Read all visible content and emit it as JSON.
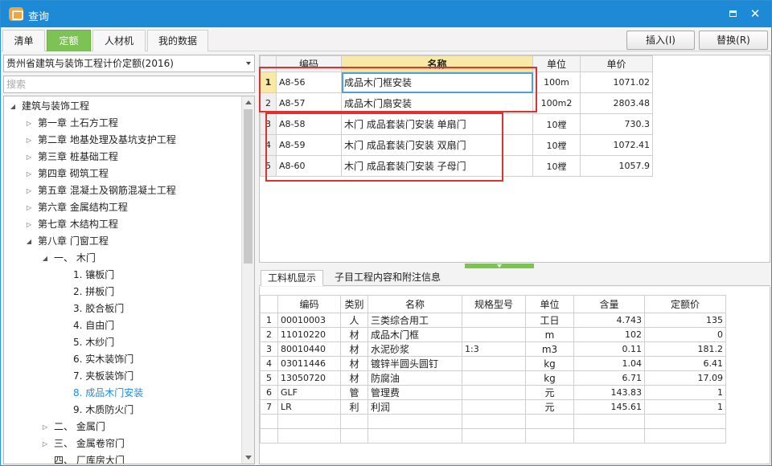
{
  "window": {
    "title": "查询",
    "maximize_label": "",
    "close_label": "✕"
  },
  "tabs": [
    "清单",
    "定额",
    "人材机",
    "我的数据"
  ],
  "toolbar": {
    "insert_label": "插入(I)",
    "replace_label": "替换(R)"
  },
  "library": {
    "selected": "贵州省建筑与装饰工程计价定额(2016)"
  },
  "search": {
    "placeholder": "搜索"
  },
  "tree": [
    {
      "label": "建筑与装饰工程",
      "state": "expanded"
    },
    {
      "label": "第一章  土石方工程",
      "state": "collapsed"
    },
    {
      "label": "第二章  地基处理及基坑支护工程",
      "state": "collapsed"
    },
    {
      "label": "第三章  桩基础工程",
      "state": "collapsed"
    },
    {
      "label": "第四章  砌筑工程",
      "state": "collapsed"
    },
    {
      "label": "第五章  混凝土及钢筋混凝土工程",
      "state": "collapsed"
    },
    {
      "label": "第六章  金属结构工程",
      "state": "collapsed"
    },
    {
      "label": "第七章  木结构工程",
      "state": "collapsed"
    },
    {
      "label": "第八章  门窗工程",
      "state": "expanded"
    },
    {
      "label": "一、  木门",
      "state": "expanded"
    },
    {
      "label": "1.  镶板门",
      "state": "leaf"
    },
    {
      "label": "2.  拼板门",
      "state": "leaf"
    },
    {
      "label": "3.  胶合板门",
      "state": "leaf"
    },
    {
      "label": "4.  自由门",
      "state": "leaf"
    },
    {
      "label": "5.  木纱门",
      "state": "leaf"
    },
    {
      "label": "6.  实木装饰门",
      "state": "leaf"
    },
    {
      "label": "7.  夹板装饰门",
      "state": "leaf"
    },
    {
      "label": "8.  成品木门安装",
      "state": "selected"
    },
    {
      "label": "9.  木质防火门",
      "state": "leaf"
    },
    {
      "label": "二、  金属门",
      "state": "collapsed"
    },
    {
      "label": "三、  金属卷帘门",
      "state": "collapsed"
    },
    {
      "label": "四、  厂库房大门",
      "state": "none"
    }
  ],
  "quota_table": {
    "headers": [
      "",
      "编码",
      "名称",
      "单位",
      "单价"
    ],
    "rows": [
      {
        "no": "1",
        "code": "A8-56",
        "name": "成品木门框安装",
        "unit": "100m",
        "price": "1071.02"
      },
      {
        "no": "2",
        "code": "A8-57",
        "name": "成品木门扇安装",
        "unit": "100m2",
        "price": "2803.48"
      },
      {
        "no": "3",
        "code": "A8-58",
        "name": "木门 成品套装门安装 单扇门",
        "unit": "10樘",
        "price": "730.3"
      },
      {
        "no": "4",
        "code": "A8-59",
        "name": "木门 成品套装门安装 双扇门",
        "unit": "10樘",
        "price": "1072.41"
      },
      {
        "no": "5",
        "code": "A8-60",
        "name": "木门 成品套装门安装 子母门",
        "unit": "10樘",
        "price": "1057.9"
      }
    ]
  },
  "sub_tabs": [
    "工料机显示",
    "子目工程内容和附注信息"
  ],
  "resource_table": {
    "headers": [
      "",
      "编码",
      "类别",
      "名称",
      "规格型号",
      "单位",
      "含量",
      "定额价"
    ],
    "rows": [
      [
        "1",
        "00010003",
        "人",
        "三类综合用工",
        "",
        "工日",
        "4.743",
        "135"
      ],
      [
        "2",
        "11010220",
        "材",
        "成品木门框",
        "",
        "m",
        "102",
        "0"
      ],
      [
        "3",
        "80010440",
        "材",
        "水泥砂浆",
        "1:3",
        "m3",
        "0.11",
        "181.2"
      ],
      [
        "4",
        "03011446",
        "材",
        "镀锌半圆头圆钉",
        "",
        "kg",
        "1.04",
        "6.41"
      ],
      [
        "5",
        "13050720",
        "材",
        "防腐油",
        "",
        "kg",
        "6.71",
        "17.09"
      ],
      [
        "6",
        "GLF",
        "管",
        "管理费",
        "",
        "元",
        "143.83",
        "1"
      ],
      [
        "7",
        "LR",
        "利",
        "利润",
        "",
        "元",
        "145.61",
        "1"
      ]
    ]
  },
  "colors": {
    "title_bar": "#1e8ad6",
    "active_tab": "#7cc254",
    "selected_tree": "#1a8ee0",
    "highlight": "#e03131",
    "header_highlight": "#f9e9a6"
  }
}
